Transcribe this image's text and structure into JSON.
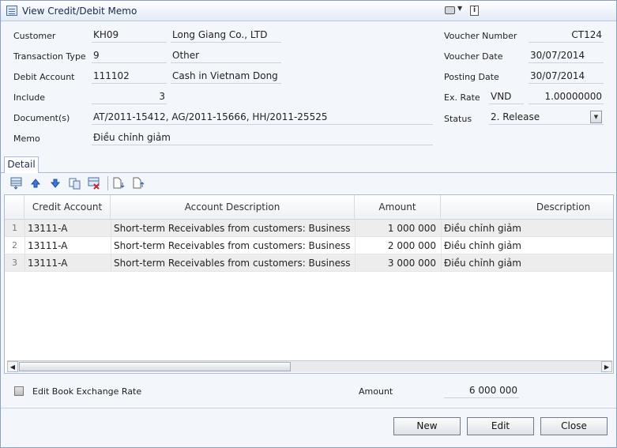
{
  "window": {
    "title": "View Credit/Debit Memo"
  },
  "form": {
    "customer": {
      "label": "Customer",
      "code": "KH09",
      "name": "Long Giang Co., LTD"
    },
    "transaction_type": {
      "label": "Transaction Type",
      "code": "9",
      "name": "Other"
    },
    "debit_account": {
      "label": "Debit Account",
      "code": "111102",
      "name": "Cash in Vietnam Dong"
    },
    "include": {
      "label": "Include",
      "value": "3"
    },
    "documents": {
      "label": "Document(s)",
      "value": "AT/2011-15412, AG/2011-15666, HH/2011-25525"
    },
    "memo": {
      "label": "Memo",
      "value": "Điều chỉnh giảm"
    },
    "voucher_number": {
      "label": "Voucher Number",
      "value": "CT124"
    },
    "voucher_date": {
      "label": "Voucher Date",
      "value": "30/07/2014"
    },
    "posting_date": {
      "label": "Posting Date",
      "value": "30/07/2014"
    },
    "ex_rate": {
      "label": "Ex. Rate",
      "currency": "VND",
      "value": "1.00000000"
    },
    "status": {
      "label": "Status",
      "value": "2. Release"
    }
  },
  "tabs": [
    {
      "label": "Detail"
    }
  ],
  "toolbar": {
    "icons": [
      "insert-row-icon",
      "move-up-icon",
      "move-down-icon",
      "copy-row-icon",
      "delete-row-icon",
      "import-icon",
      "export-icon"
    ]
  },
  "grid": {
    "columns": [
      "",
      "Credit Account",
      "Account Description",
      "Amount",
      "Description"
    ],
    "rows": [
      {
        "num": "1",
        "account": "13111-A",
        "desc": "Short-term Receivables from customers: Business",
        "amount": "1 000 000",
        "memo": "Điều chỉnh giảm"
      },
      {
        "num": "2",
        "account": "13111-A",
        "desc": "Short-term Receivables from customers: Business",
        "amount": "2 000 000",
        "memo": "Điều chỉnh giảm"
      },
      {
        "num": "3",
        "account": "13111-A",
        "desc": "Short-term Receivables from customers: Business",
        "amount": "3 000 000",
        "memo": "Điều chỉnh giảm"
      }
    ]
  },
  "footer": {
    "edit_rate_label": "Edit Book Exchange Rate",
    "amount_label": "Amount",
    "amount_value": "6 000 000"
  },
  "buttons": {
    "new": "New",
    "edit": "Edit",
    "close": "Close"
  },
  "colors": {
    "accent": "#4a6f9c",
    "border": "#a8bcd6",
    "background": "#f3f6fb"
  }
}
